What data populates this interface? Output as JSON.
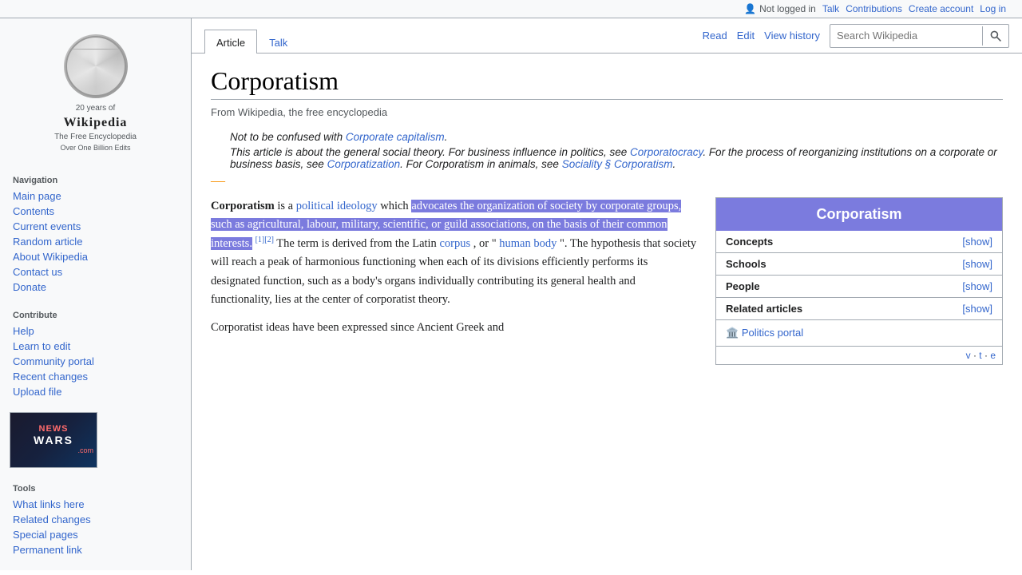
{
  "topbar": {
    "not_logged_in": "Not logged in",
    "talk": "Talk",
    "contributions": "Contributions",
    "create_account": "Create account",
    "log_in": "Log in"
  },
  "logo": {
    "title": "Wikipedia",
    "subtitle": "The Free Encyclopedia",
    "years": "20 years of",
    "billion": "Over One Billion Edits"
  },
  "sidebar": {
    "navigation_title": "Navigation",
    "nav_items": [
      {
        "label": "Main page",
        "id": "main-page"
      },
      {
        "label": "Contents",
        "id": "contents"
      },
      {
        "label": "Current events",
        "id": "current-events"
      },
      {
        "label": "Random article",
        "id": "random-article"
      },
      {
        "label": "About Wikipedia",
        "id": "about-wikipedia"
      },
      {
        "label": "Contact us",
        "id": "contact-us"
      },
      {
        "label": "Donate",
        "id": "donate"
      }
    ],
    "contribute_title": "Contribute",
    "contribute_items": [
      {
        "label": "Help",
        "id": "help"
      },
      {
        "label": "Learn to edit",
        "id": "learn-to-edit"
      },
      {
        "label": "Community portal",
        "id": "community-portal"
      },
      {
        "label": "Recent changes",
        "id": "recent-changes"
      },
      {
        "label": "Upload file",
        "id": "upload-file"
      }
    ],
    "tools_title": "Tools",
    "tools_items": [
      {
        "label": "What links here",
        "id": "what-links-here"
      },
      {
        "label": "Related changes",
        "id": "related-changes"
      },
      {
        "label": "Special pages",
        "id": "special-pages"
      },
      {
        "label": "Permanent link",
        "id": "permanent-link"
      }
    ]
  },
  "tabs": {
    "article": "Article",
    "talk": "Talk",
    "read": "Read",
    "edit": "Edit",
    "view_history": "View history"
  },
  "search": {
    "placeholder": "Search Wikipedia"
  },
  "article": {
    "title": "Corporatism",
    "from_line": "From Wikipedia, the free encyclopedia",
    "hatnotes": [
      "Not to be confused with Corporate capitalism.",
      "This article is about the general social theory. For business influence in politics, see Corporatocracy. For the process of reorganizing institutions on a corporate or business basis, see Corporatization. For Corporatism in animals, see Sociality § Corporatism."
    ],
    "body_intro": "Corporatism",
    "body_is_a": " is a ",
    "body_pol_ideology": "political ideology",
    "body_which": " which ",
    "body_highlighted": "advocates the organization of society by corporate groups, such as agricultural, labour, military, scientific, or guild associations, on the basis of their common interests.",
    "body_refs": "[1][2]",
    "body_after": " The term is derived from the Latin corpus, or \"human body\". The hypothesis that society will reach a peak of harmonious functioning when each of its divisions efficiently performs its designated function, such as a body's organs individually contributing its general health and functionality, lies at the center of corporatist theory.",
    "body_para2": "Corporatist ideas have been expressed since Ancient Greek and",
    "section_divider": "—",
    "corpus_link": "corpus",
    "human_body_link": "human body"
  },
  "infobox": {
    "title": "Corporatism",
    "rows": [
      {
        "label": "Concepts",
        "show": "[show]"
      },
      {
        "label": "Schools",
        "show": "[show]"
      },
      {
        "label": "People",
        "show": "[show]"
      },
      {
        "label": "Related articles",
        "show": "[show]"
      }
    ],
    "portal_icon": "🏛️",
    "portal_label": "Politics portal",
    "vte": "v · t · e"
  }
}
